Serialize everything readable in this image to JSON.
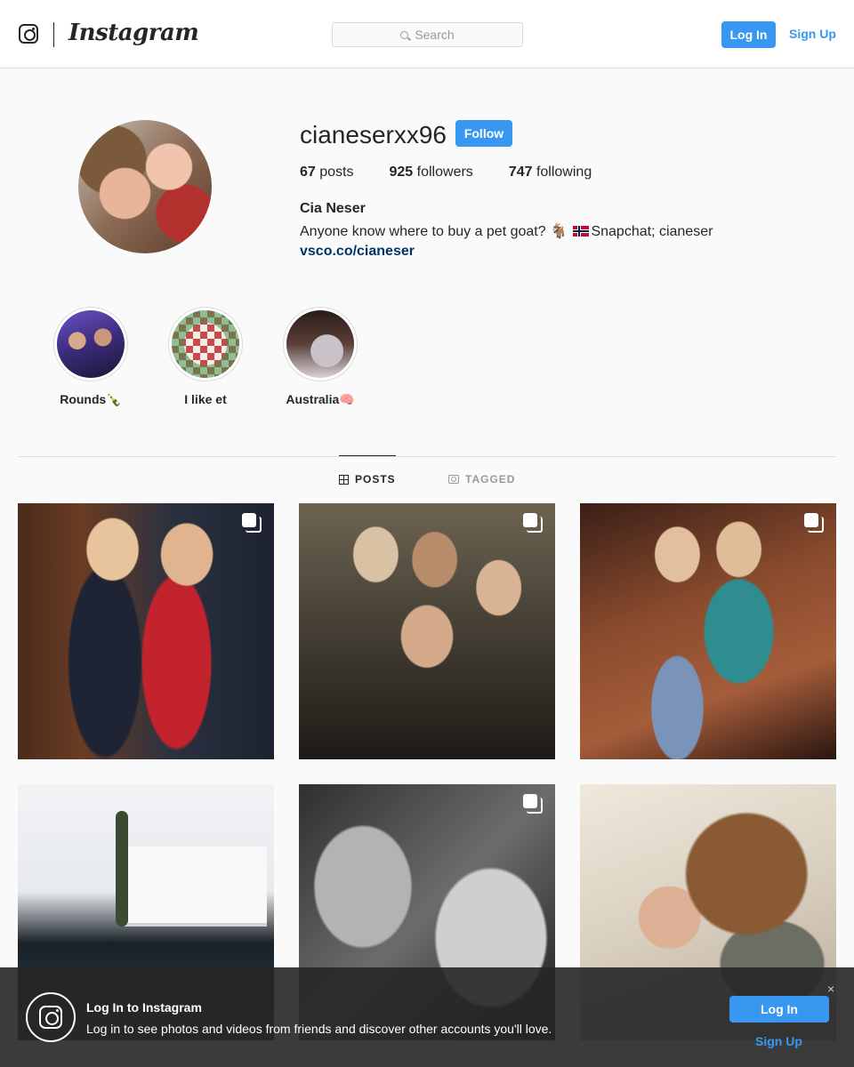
{
  "header": {
    "brand": "Instagram",
    "search_placeholder": "Search",
    "login_label": "Log In",
    "signup_label": "Sign Up"
  },
  "profile": {
    "username": "cianeserxx96",
    "follow_label": "Follow",
    "posts_count": "67",
    "posts_label": "posts",
    "followers_count": "925",
    "followers_label": "followers",
    "following_count": "747",
    "following_label": "following",
    "full_name": "Cia Neser",
    "bio_before": "Anyone know where to buy a pet goat? 🐐 ",
    "bio_after": "Snapchat; cianeser",
    "website": "vsco.co/cianeser"
  },
  "highlights": [
    {
      "label": "Rounds🍾"
    },
    {
      "label": "I like et"
    },
    {
      "label": "Australia🧠"
    }
  ],
  "tabs": {
    "posts": "POSTS",
    "tagged": "TAGGED"
  },
  "login_banner": {
    "title": "Log In to Instagram",
    "text": "Log in to see photos and videos from friends and discover other accounts you'll love.",
    "close": "×",
    "login_label": "Log In",
    "signup_label": "Sign Up"
  },
  "colors": {
    "accent": "#3897f0",
    "link": "#003569",
    "text": "#262626",
    "border": "#dbdbdb",
    "background": "#fafafa"
  }
}
